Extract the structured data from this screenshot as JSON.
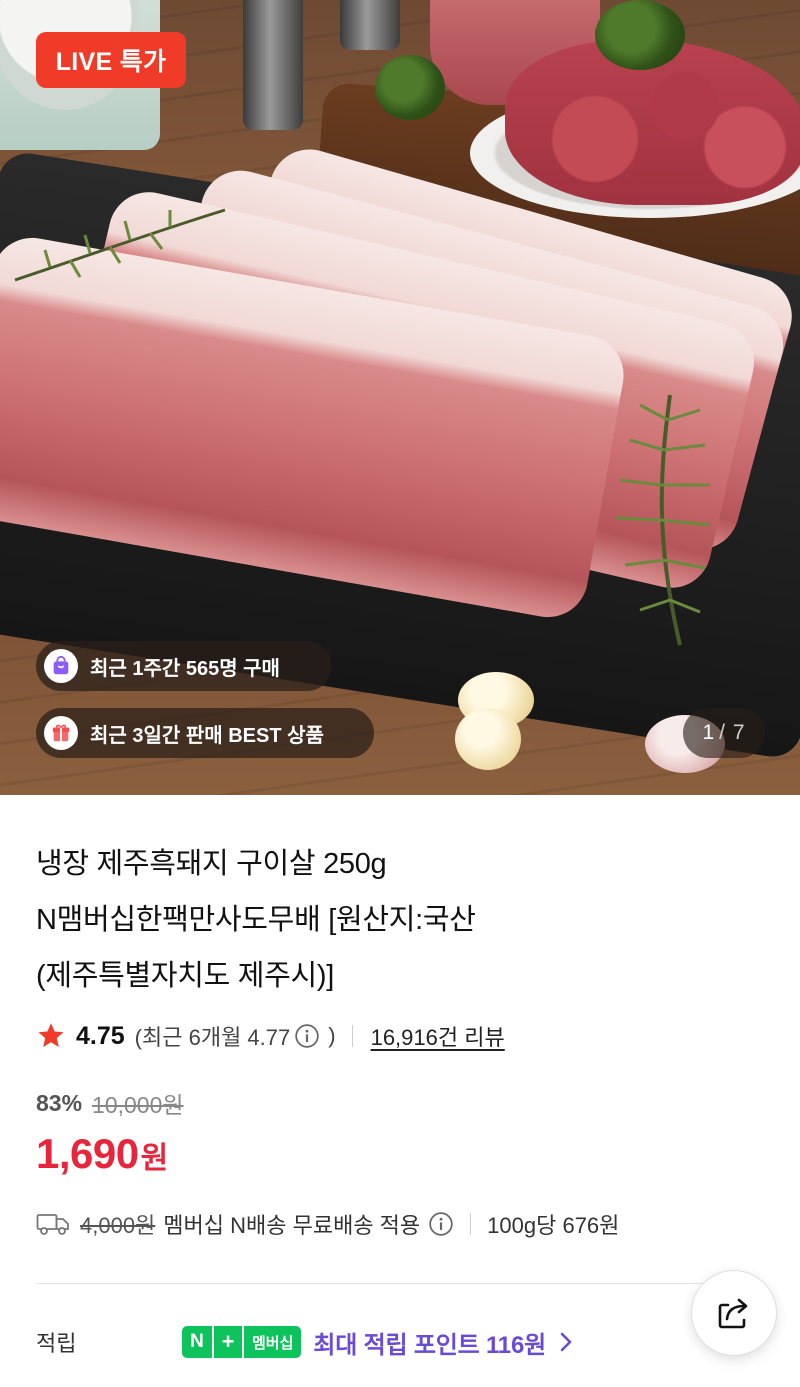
{
  "hero": {
    "live_badge": "LIVE 특가",
    "pill_purchases": "최근 1주간 565명 구매",
    "pill_best": "최근 3일간 판매 BEST 상품",
    "pager_current": "1",
    "pager_total": "/ 7"
  },
  "product": {
    "title_line1": "냉장 제주흑돼지 구이살 250g",
    "title_line2": "N맴버십한팩만사도무배 [원산지:국산",
    "title_line3": "(제주특별자치도 제주시)]"
  },
  "rating": {
    "score": "4.75",
    "recent": "(최근 6개월 4.77",
    "recent_close": ")",
    "reviews": "16,916건 리뷰"
  },
  "price": {
    "discount_pct": "83%",
    "original": "10,000원",
    "sale": "1,690",
    "currency": "원"
  },
  "shipping": {
    "original_fee": "4,000원",
    "label": "멤버십 N배송 무료배송 적용",
    "unit_price": "100g당 676원"
  },
  "points": {
    "label": "적립",
    "badge_n": "N",
    "badge_plus": "+",
    "badge_member": "멤버십",
    "text": "최대 적립 포인트 116원"
  },
  "colors": {
    "live_red": "#ef3b28",
    "price_red": "#e8263b",
    "points_purple": "#6a4bd6",
    "npay_green": "#0fc35c",
    "star_red": "#ef3b28"
  },
  "icons": {
    "star": "star-icon",
    "info": "info-circle-icon",
    "truck": "truck-icon",
    "chevron": "chevron-right-icon",
    "share": "share-icon",
    "bag": "shopping-bag-icon",
    "gift": "gift-icon"
  }
}
